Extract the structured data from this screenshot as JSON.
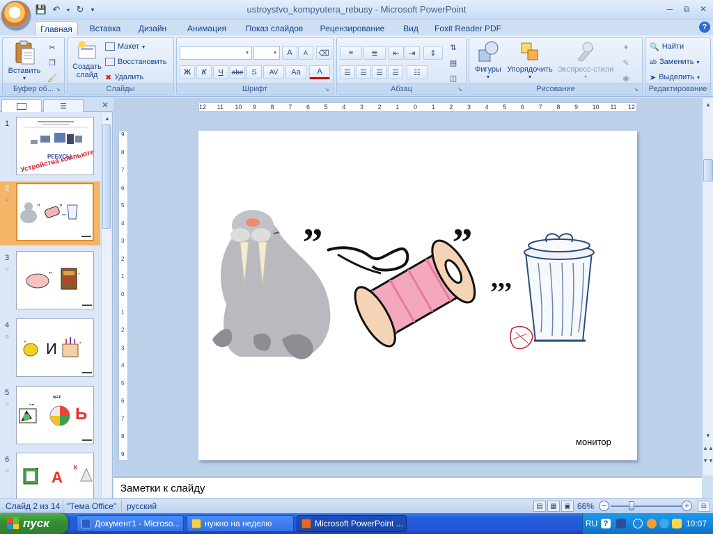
{
  "window": {
    "title": "ustroystvo_kompyutera_rebusy - Microsoft PowerPoint"
  },
  "tabs": [
    {
      "label": "Главная",
      "active": true
    },
    {
      "label": "Вставка"
    },
    {
      "label": "Дизайн"
    },
    {
      "label": "Анимация"
    },
    {
      "label": "Показ слайдов"
    },
    {
      "label": "Рецензирование"
    },
    {
      "label": "Вид"
    },
    {
      "label": "Foxit Reader PDF"
    }
  ],
  "ribbon": {
    "clipboard": {
      "label": "Буфер об...",
      "paste": "Вставить"
    },
    "slides": {
      "label": "Слайды",
      "new_slide_line1": "Создать",
      "new_slide_line2": "слайд",
      "layout": "Макет",
      "reset": "Восстановить",
      "delete": "Удалить"
    },
    "font": {
      "label": "Шрифт",
      "bold": "Ж",
      "italic": "К",
      "underline": "Ч",
      "strike": "abe",
      "shadow": "S",
      "spacing": "AV",
      "case": "Aa",
      "color": "A",
      "grow": "A",
      "shrink": "A"
    },
    "paragraph": {
      "label": "Абзац"
    },
    "drawing": {
      "label": "Рисование",
      "shapes": "Фигуры",
      "arrange": "Упорядочить",
      "styles": "Экспресс-стили"
    },
    "editing": {
      "label": "Редактирование",
      "find": "Найти",
      "replace": "Заменить",
      "select": "Выделить"
    }
  },
  "slides_pane": {
    "thumbnails": [
      {
        "num": "1",
        "title": "РЕБУСЫ",
        "subtitle": "Устройства компьютера"
      },
      {
        "num": "2",
        "selected": true
      },
      {
        "num": "3"
      },
      {
        "num": "4",
        "letter": "И"
      },
      {
        "num": "5",
        "letter": "Ь",
        "marks": "ч=т"
      },
      {
        "num": "6",
        "letter": "А",
        "marks": "К"
      }
    ]
  },
  "ruler": {
    "h_ticks": [
      "12",
      "11",
      "10",
      "9",
      "8",
      "7",
      "6",
      "5",
      "4",
      "3",
      "2",
      "1",
      "0",
      "1",
      "2",
      "3",
      "4",
      "5",
      "6",
      "7",
      "8",
      "9",
      "10",
      "11",
      "12"
    ],
    "v_ticks": [
      "9",
      "8",
      "7",
      "6",
      "5",
      "4",
      "3",
      "2",
      "1",
      "0",
      "1",
      "2",
      "3",
      "4",
      "5",
      "6",
      "7",
      "8",
      "9"
    ]
  },
  "slide": {
    "caption": "монитор",
    "marks": {
      "walrus": "„",
      "spool": "„",
      "bin": ",,,"
    }
  },
  "notes": {
    "placeholder": "Заметки к слайду"
  },
  "status": {
    "slide": "Слайд 2 из 14",
    "theme": "\"Тема Office\"",
    "language": "русский",
    "zoom": "66%"
  },
  "taskbar": {
    "start": "пуск",
    "tasks": [
      {
        "label": "Документ1 - Microso..."
      },
      {
        "label": "нужно на неделю"
      },
      {
        "label": "Microsoft PowerPoint ...",
        "active": true
      }
    ],
    "lang": "RU",
    "time": "10:07"
  },
  "colors": {
    "accent": "#e08a2c",
    "ribbon": "#dce8f8",
    "taskbar": "#245edb"
  }
}
